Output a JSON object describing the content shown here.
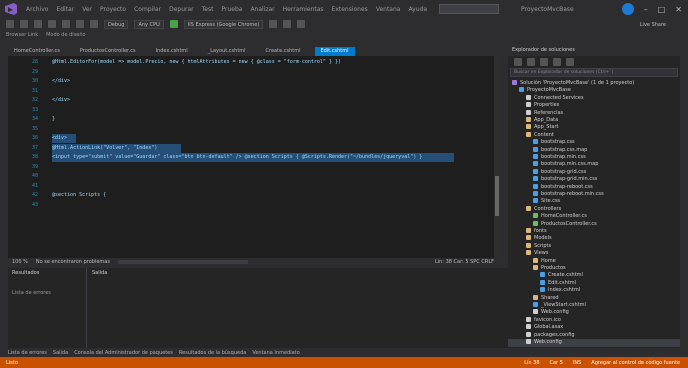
{
  "titlebar": {
    "menus": [
      "Archivo",
      "Editar",
      "Ver",
      "Proyecto",
      "Compilar",
      "Depurar",
      "Test",
      "Prueba",
      "Analizar",
      "Herramientas",
      "Extensiones",
      "Ventana",
      "Ayuda"
    ],
    "search_placeholder": "Buscar (Ctrl+Q)",
    "title": "ProyectoMvcBase"
  },
  "toolbar": {
    "debug_config": "Debug",
    "platform": "Any CPU",
    "run_target": "IIS Express (Google Chrome)",
    "liveshare": "Live Share"
  },
  "toolbar2": {
    "items": [
      "Browser Link",
      "Modo de diseño"
    ]
  },
  "tabs": [
    {
      "label": "HomeController.cs",
      "active": false
    },
    {
      "label": "ProductosController.cs",
      "active": false
    },
    {
      "label": "Index.cshtml",
      "active": false
    },
    {
      "label": "_Layout.cshtml",
      "active": false
    },
    {
      "label": "Create.cshtml",
      "active": false
    },
    {
      "label": "Edit.cshtml",
      "active": true
    }
  ],
  "code_lines": [
    {
      "n": "28",
      "text": "    @Html.EditorFor(model => model.Precio, new { htmlAttributes = new { @class = \"form-control\" } })",
      "sel": false
    },
    {
      "n": "29",
      "text": "",
      "sel": false
    },
    {
      "n": "30",
      "text": "    </div>",
      "sel": false
    },
    {
      "n": "31",
      "text": "",
      "sel": false
    },
    {
      "n": "32",
      "text": "  </div>",
      "sel": false
    },
    {
      "n": "33",
      "text": "",
      "sel": false
    },
    {
      "n": "34",
      "text": "}",
      "sel": false
    },
    {
      "n": "35",
      "text": "",
      "sel": false
    },
    {
      "n": "36",
      "text": "<div>",
      "sel": true
    },
    {
      "n": "37",
      "text": "    @Html.ActionLink(\"Volver\", \"Index\")",
      "sel": true
    },
    {
      "n": "38",
      "text": "    <input type=\"submit\" value=\"Guardar\" class=\"btn btn-default\" /> @section Scripts { @Scripts.Render(\"~/bundles/jqueryval\") }",
      "sel": true
    },
    {
      "n": "39",
      "text": "",
      "sel": false
    },
    {
      "n": "40",
      "text": "",
      "sel": false
    },
    {
      "n": "41",
      "text": "",
      "sel": false
    },
    {
      "n": "42",
      "text": "@section Scripts {",
      "sel": false
    },
    {
      "n": "43",
      "text": "",
      "sel": false
    }
  ],
  "editor_status": {
    "zoom": "100 %",
    "issues": "No se encontraron problemas",
    "position": "Lín: 38  Car: 5  SPC  CRLF"
  },
  "bottom_panels": {
    "left_title": "Resultados",
    "left_subtitle": "Lista de errores",
    "right_title": "Salida"
  },
  "solution_explorer": {
    "title": "Explorador de soluciones",
    "search_placeholder": "Buscar en Explorador de soluciones (Ctrl+`)",
    "items": [
      {
        "label": "Solución 'ProyectoMvcBase' (1 de 1 proyecto)",
        "indent": 0,
        "color": "#9b7cd6"
      },
      {
        "label": "ProyectoMvcBase",
        "indent": 1,
        "color": "#4aa0e6"
      },
      {
        "label": "Connected Services",
        "indent": 2,
        "color": "#cfcfcf"
      },
      {
        "label": "Properties",
        "indent": 2,
        "color": "#cfcfcf"
      },
      {
        "label": "Referencias",
        "indent": 2,
        "color": "#cfcfcf"
      },
      {
        "label": "App_Data",
        "indent": 2,
        "color": "#dcb67a"
      },
      {
        "label": "App_Start",
        "indent": 2,
        "color": "#dcb67a"
      },
      {
        "label": "Content",
        "indent": 2,
        "color": "#dcb67a"
      },
      {
        "label": "bootstrap.css",
        "indent": 3,
        "color": "#4aa0e6"
      },
      {
        "label": "bootstrap.css.map",
        "indent": 3,
        "color": "#4aa0e6"
      },
      {
        "label": "bootstrap.min.css",
        "indent": 3,
        "color": "#4aa0e6"
      },
      {
        "label": "bootstrap.min.css.map",
        "indent": 3,
        "color": "#4aa0e6"
      },
      {
        "label": "bootstrap-grid.css",
        "indent": 3,
        "color": "#4aa0e6"
      },
      {
        "label": "bootstrap-grid.min.css",
        "indent": 3,
        "color": "#4aa0e6"
      },
      {
        "label": "bootstrap-reboot.css",
        "indent": 3,
        "color": "#4aa0e6"
      },
      {
        "label": "bootstrap-reboot.min.css",
        "indent": 3,
        "color": "#4aa0e6"
      },
      {
        "label": "Site.css",
        "indent": 3,
        "color": "#4aa0e6"
      },
      {
        "label": "Controllers",
        "indent": 2,
        "color": "#dcb67a"
      },
      {
        "label": "HomeController.cs",
        "indent": 3,
        "color": "#68c068"
      },
      {
        "label": "ProductosController.cs",
        "indent": 3,
        "color": "#68c068"
      },
      {
        "label": "fonts",
        "indent": 2,
        "color": "#dcb67a"
      },
      {
        "label": "Models",
        "indent": 2,
        "color": "#dcb67a"
      },
      {
        "label": "Scripts",
        "indent": 2,
        "color": "#dcb67a"
      },
      {
        "label": "Views",
        "indent": 2,
        "color": "#dcb67a"
      },
      {
        "label": "Home",
        "indent": 3,
        "color": "#dcb67a"
      },
      {
        "label": "Productos",
        "indent": 3,
        "color": "#dcb67a"
      },
      {
        "label": "Create.cshtml",
        "indent": 4,
        "color": "#4aa0e6"
      },
      {
        "label": "Edit.cshtml",
        "indent": 4,
        "color": "#4aa0e6"
      },
      {
        "label": "Index.cshtml",
        "indent": 4,
        "color": "#4aa0e6"
      },
      {
        "label": "Shared",
        "indent": 3,
        "color": "#dcb67a"
      },
      {
        "label": "_ViewStart.cshtml",
        "indent": 3,
        "color": "#4aa0e6"
      },
      {
        "label": "Web.config",
        "indent": 3,
        "color": "#cfcfcf"
      },
      {
        "label": "favicon.ico",
        "indent": 2,
        "color": "#cfcfcf"
      },
      {
        "label": "Global.asax",
        "indent": 2,
        "color": "#cfcfcf"
      },
      {
        "label": "packages.config",
        "indent": 2,
        "color": "#cfcfcf"
      },
      {
        "label": "Web.config",
        "indent": 2,
        "color": "#cfcfcf",
        "selected": true
      }
    ]
  },
  "bottom_tabs": [
    "Lista de errores",
    "Salida",
    "Consola del Administrador de paquetes",
    "Resultados de la búsqueda",
    "Ventana Inmediato"
  ],
  "statusbar": {
    "left": "Listo",
    "right": [
      "Lín 38",
      "Car 5",
      "INS",
      "Agregar al control de código fuente"
    ]
  },
  "colors": {
    "accent": "#007acc",
    "status": "#ca5100",
    "selection": "#264f78"
  }
}
